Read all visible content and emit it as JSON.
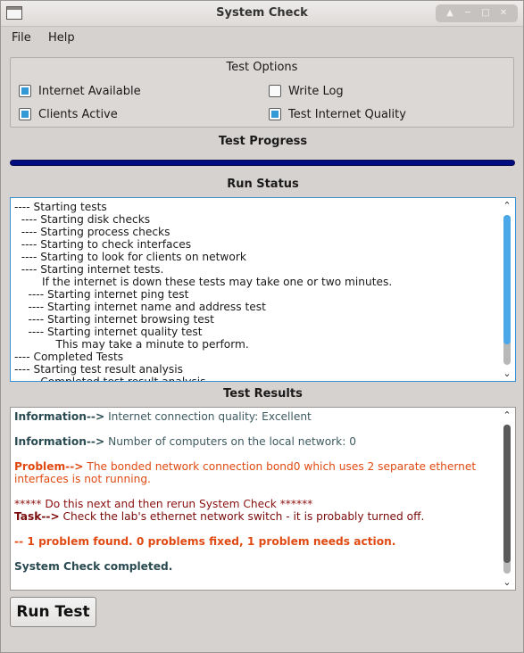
{
  "window": {
    "title": "System Check"
  },
  "menu": {
    "file": "File",
    "help": "Help"
  },
  "test_options": {
    "title": "Test Options",
    "internet_available": {
      "label": "Internet Available",
      "checked": true
    },
    "write_log": {
      "label": "Write Log",
      "checked": false
    },
    "clients_active": {
      "label": "Clients Active",
      "checked": true
    },
    "test_internet_quality": {
      "label": "Test Internet Quality",
      "checked": true
    }
  },
  "progress": {
    "label": "Test Progress",
    "value_percent": 100,
    "color": "#000d80"
  },
  "run_status": {
    "label": "Run Status",
    "lines": [
      "---- Starting tests",
      "  ---- Starting disk checks",
      "  ---- Starting process checks",
      "  ---- Starting to check interfaces",
      "  ---- Starting to look for clients on network",
      "  ---- Starting internet tests.",
      "        If the internet is down these tests may take one or two minutes.",
      "    ---- Starting internet ping test",
      "    ---- Starting internet name and address test",
      "    ---- Starting internet browsing test",
      "    ---- Starting internet quality test",
      "            This may take a minute to perform.",
      "---- Completed Tests",
      "---- Starting test result analysis",
      "  ---- Completed test result analysis"
    ]
  },
  "test_results": {
    "label": "Test Results",
    "info1_tag": "Information-->",
    "info1_text": " Internet connection quality: Excellent",
    "info2_tag": "Information-->",
    "info2_text": " Number of computers on the local network: 0",
    "problem_tag": "Problem-->",
    "problem_text": " The bonded network connection bond0 which uses 2 separate ethernet interfaces is not running.",
    "next_text": "***** Do this next and then rerun System Check ******",
    "task_tag": "Task-->",
    "task_text": " Check the lab's ethernet network switch - it is probably turned off.",
    "summary": "-- 1 problem found. 0 problems fixed, 1 problem needs action.",
    "completed": "System Check completed."
  },
  "buttons": {
    "run_test": "Run Test"
  },
  "icons": {
    "app": "window-app-icon",
    "shade": "shade-icon",
    "minimize": "minimize-icon",
    "maximize": "maximize-icon",
    "close": "close-icon",
    "scroll_up": "chevron-up-icon",
    "scroll_down": "chevron-down-icon"
  },
  "colors": {
    "accent": "#3398d6",
    "progress": "#000d80",
    "problem": "#e04a12",
    "task": "#7a0a0a",
    "info": "#2a4a52"
  }
}
